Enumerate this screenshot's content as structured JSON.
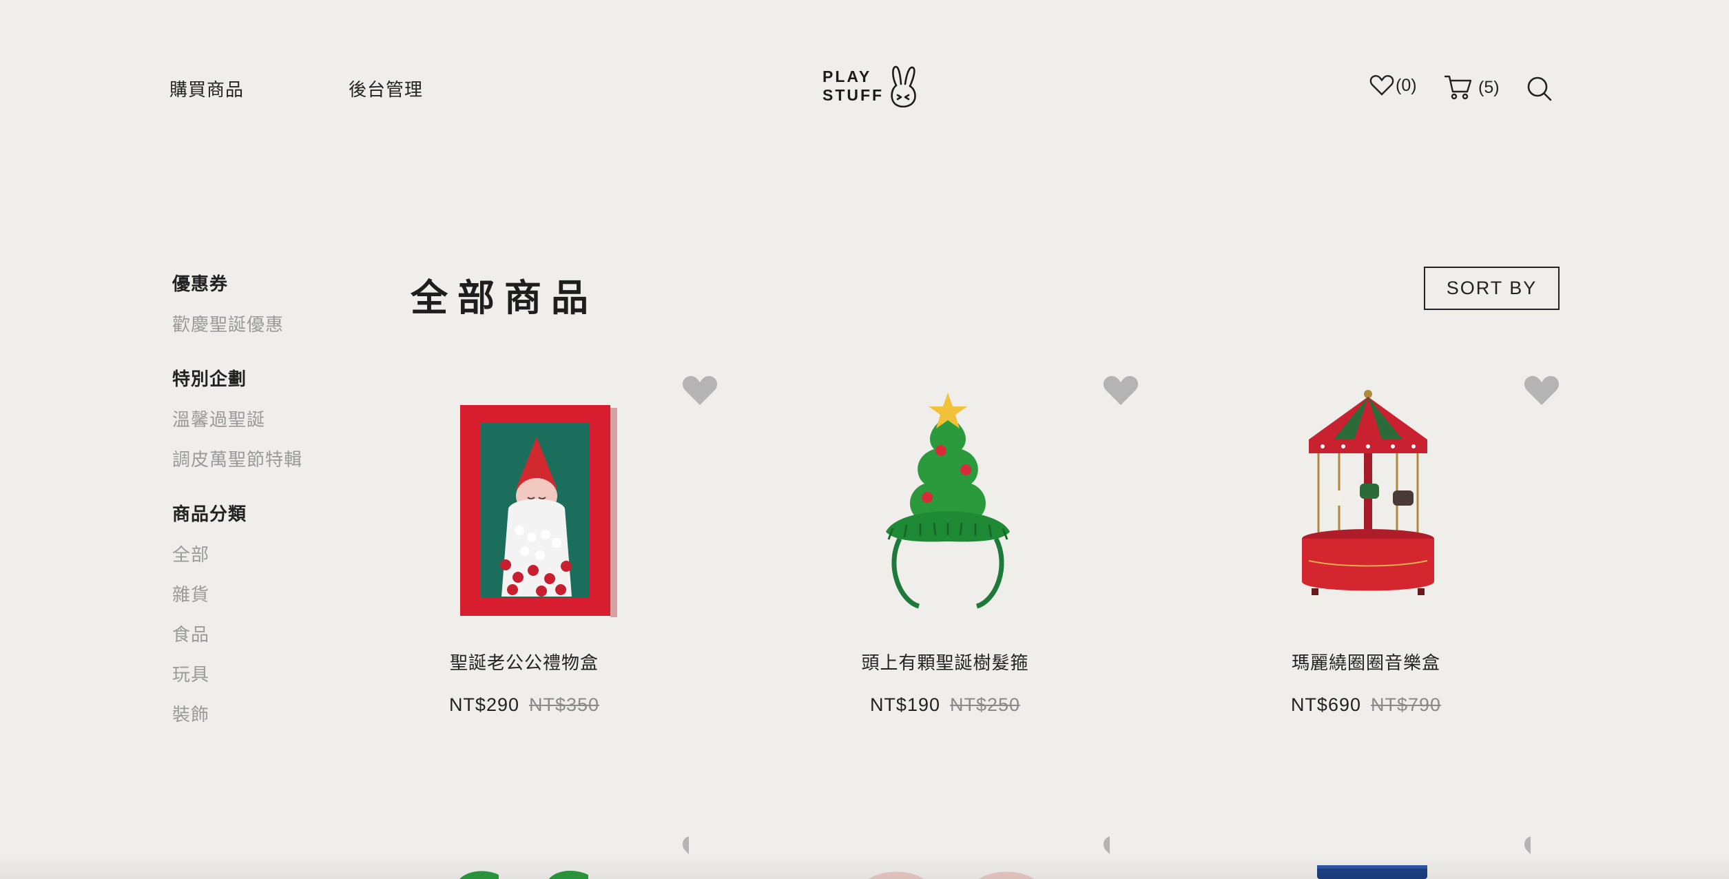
{
  "header": {
    "nav": [
      "購買商品",
      "後台管理"
    ],
    "logo": {
      "line1": "PLAY",
      "line2": "STUFF"
    },
    "wishlist_count": "(0)",
    "cart_count": "(5)"
  },
  "sidebar": {
    "sections": [
      {
        "title": "優惠券",
        "items": [
          "歡慶聖誕優惠"
        ]
      },
      {
        "title": "特別企劃",
        "items": [
          "溫馨過聖誕",
          "調皮萬聖節特輯"
        ]
      },
      {
        "title": "商品分類",
        "items": [
          "全部",
          "雜貨",
          "食品",
          "玩具",
          "裝飾"
        ]
      }
    ]
  },
  "main": {
    "title": "全部商品",
    "sort_label": "SORT BY",
    "products": [
      {
        "name": "聖誕老公公禮物盒",
        "price": "NT$290",
        "original_price": "NT$350"
      },
      {
        "name": "頭上有顆聖誕樹髮箍",
        "price": "NT$190",
        "original_price": "NT$250"
      },
      {
        "name": "瑪麗繞圈圈音樂盒",
        "price": "NT$690",
        "original_price": "NT$790"
      }
    ]
  },
  "colors": {
    "background": "#efeeea",
    "heart": "#b4b4b4",
    "muted_text": "#9a9a9a"
  }
}
